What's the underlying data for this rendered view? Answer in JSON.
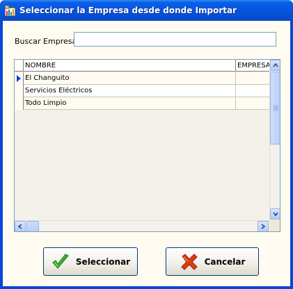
{
  "window": {
    "title": "Seleccionar la Empresa desde donde Importar"
  },
  "search": {
    "label": "Buscar Empresa:",
    "value": "",
    "placeholder": ""
  },
  "grid": {
    "columns": [
      "NOMBRE",
      "EMPRESA"
    ],
    "rows": [
      {
        "nombre": "El Changuito",
        "empresa": "",
        "selected": true
      },
      {
        "nombre": "Servicios Eléctricos",
        "empresa": "",
        "selected": false
      },
      {
        "nombre": "Todo Limpio",
        "empresa": "",
        "selected": false
      }
    ]
  },
  "buttons": {
    "select_label": "Seleccionar",
    "cancel_label": "Cancelar"
  },
  "colors": {
    "titlebar": "#0556e0",
    "client_background": "#fffbf0",
    "select_icon": "#3cb034",
    "cancel_icon": "#e03a14"
  },
  "icons": {
    "title": "app-icon",
    "select": "checkmark-icon",
    "cancel": "x-icon"
  }
}
